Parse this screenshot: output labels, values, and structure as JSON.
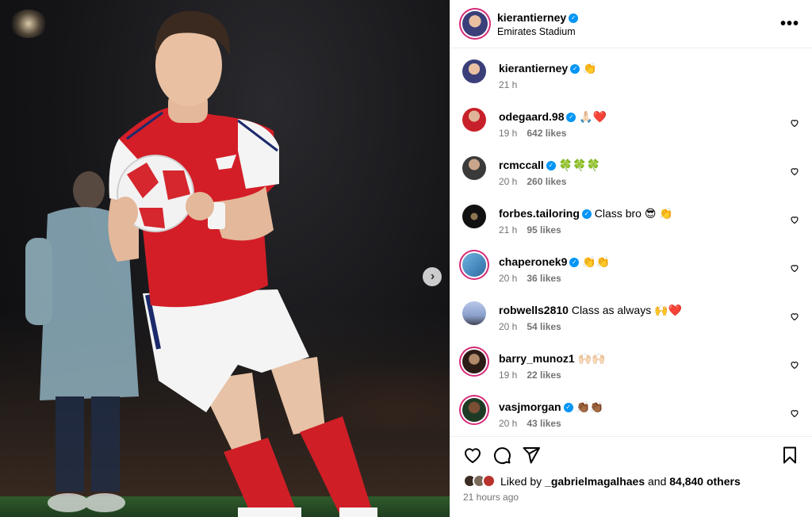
{
  "post": {
    "username": "kierantierney",
    "location": "Emirates Stadium",
    "more_label": "•••"
  },
  "caption": {
    "username": "kierantierney",
    "text": "👏",
    "time": "21 h"
  },
  "comments": [
    {
      "username": "odegaard.98",
      "verified": true,
      "text": "🙏🏻❤️",
      "time": "19 h",
      "likes": "642 likes"
    },
    {
      "username": "rcmccall",
      "verified": true,
      "text": "🍀🍀🍀",
      "time": "20 h",
      "likes": "260 likes"
    },
    {
      "username": "forbes.tailoring",
      "verified": true,
      "text": "Class bro 😎 👏",
      "time": "21 h",
      "likes": "95 likes"
    },
    {
      "username": "chaperonek9",
      "verified": true,
      "text": "👏👏",
      "time": "20 h",
      "likes": "36 likes"
    },
    {
      "username": "robwells2810",
      "verified": false,
      "text": "Class as always 🙌❤️",
      "time": "20 h",
      "likes": "54 likes"
    },
    {
      "username": "barry_munoz1",
      "verified": false,
      "text": "🙌🏻🙌🏻",
      "time": "19 h",
      "likes": "22 likes"
    },
    {
      "username": "vasjmorgan",
      "verified": true,
      "text": "👏🏾👏🏾",
      "time": "20 h",
      "likes": "43 likes"
    }
  ],
  "footer": {
    "liked_prefix": "Liked by",
    "liked_user": "_gabrielmagalhaes",
    "liked_and": "and",
    "liked_others": "84,840 others",
    "time_ago": "21 hours ago"
  },
  "icons": {
    "like": "heart-icon",
    "comment": "comment-icon",
    "share": "share-icon",
    "save": "bookmark-icon",
    "next": "chevron-right-icon"
  },
  "colors": {
    "verified": "#0095f6",
    "story_ring": "#d62976",
    "secondary_text": "#737373",
    "arsenal_red": "#d31e27"
  }
}
